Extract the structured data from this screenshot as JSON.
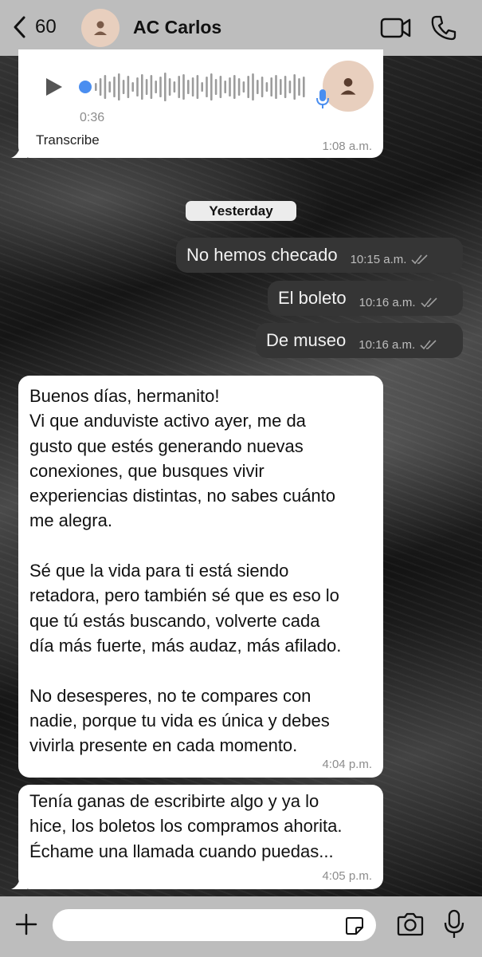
{
  "header": {
    "back_count": "60",
    "contact_name": "AC Carlos"
  },
  "voice_message": {
    "duration": "0:36",
    "transcribe_label": "Transcribe",
    "time": "1:08 a.m."
  },
  "date_separator": "Yesterday",
  "outgoing": [
    {
      "text": "No hemos checado",
      "time": "10:15 a.m."
    },
    {
      "text": "El boleto",
      "time": "10:16 a.m."
    },
    {
      "text": "De museo",
      "time": "10:16 a.m."
    }
  ],
  "incoming": [
    {
      "text": "Buenos días, hermanito!\nVi que anduviste activo ayer, me da\ngusto que estés generando nuevas\nconexiones, que busques vivir\nexperiencias distintas, no sabes cuánto\nme alegra.\n\nSé que la vida para ti está siendo\nretadora, pero también sé que es eso lo\nque tú estás buscando, volverte cada\ndía más fuerte, más audaz, más afilado.\n\nNo desesperes, no te compares con\nnadie, porque tu vida es única y debes\nvivirla presente en cada momento.",
      "time": "4:04 p.m."
    },
    {
      "text": "Tenía ganas de escribirte algo y ya lo\nhice, los boletos los compramos ahorita.\nÉchame una llamada cuando puedas...",
      "time": "4:05 p.m."
    }
  ],
  "composer": {
    "placeholder": ""
  },
  "icons": {
    "back": "chevron-left-icon",
    "video": "video-camera-icon",
    "phone": "phone-icon",
    "play": "play-icon",
    "mic": "microphone-icon",
    "read": "double-check-icon",
    "plus": "plus-icon",
    "sticker": "sticker-icon",
    "camera": "camera-icon"
  },
  "colors": {
    "header_bg": "#bdbdbd",
    "outgoing_bg": "#353535",
    "incoming_bg": "#ffffff",
    "accent_blue": "#4a8ef0",
    "avatar_bg": "#e8cfbe"
  }
}
